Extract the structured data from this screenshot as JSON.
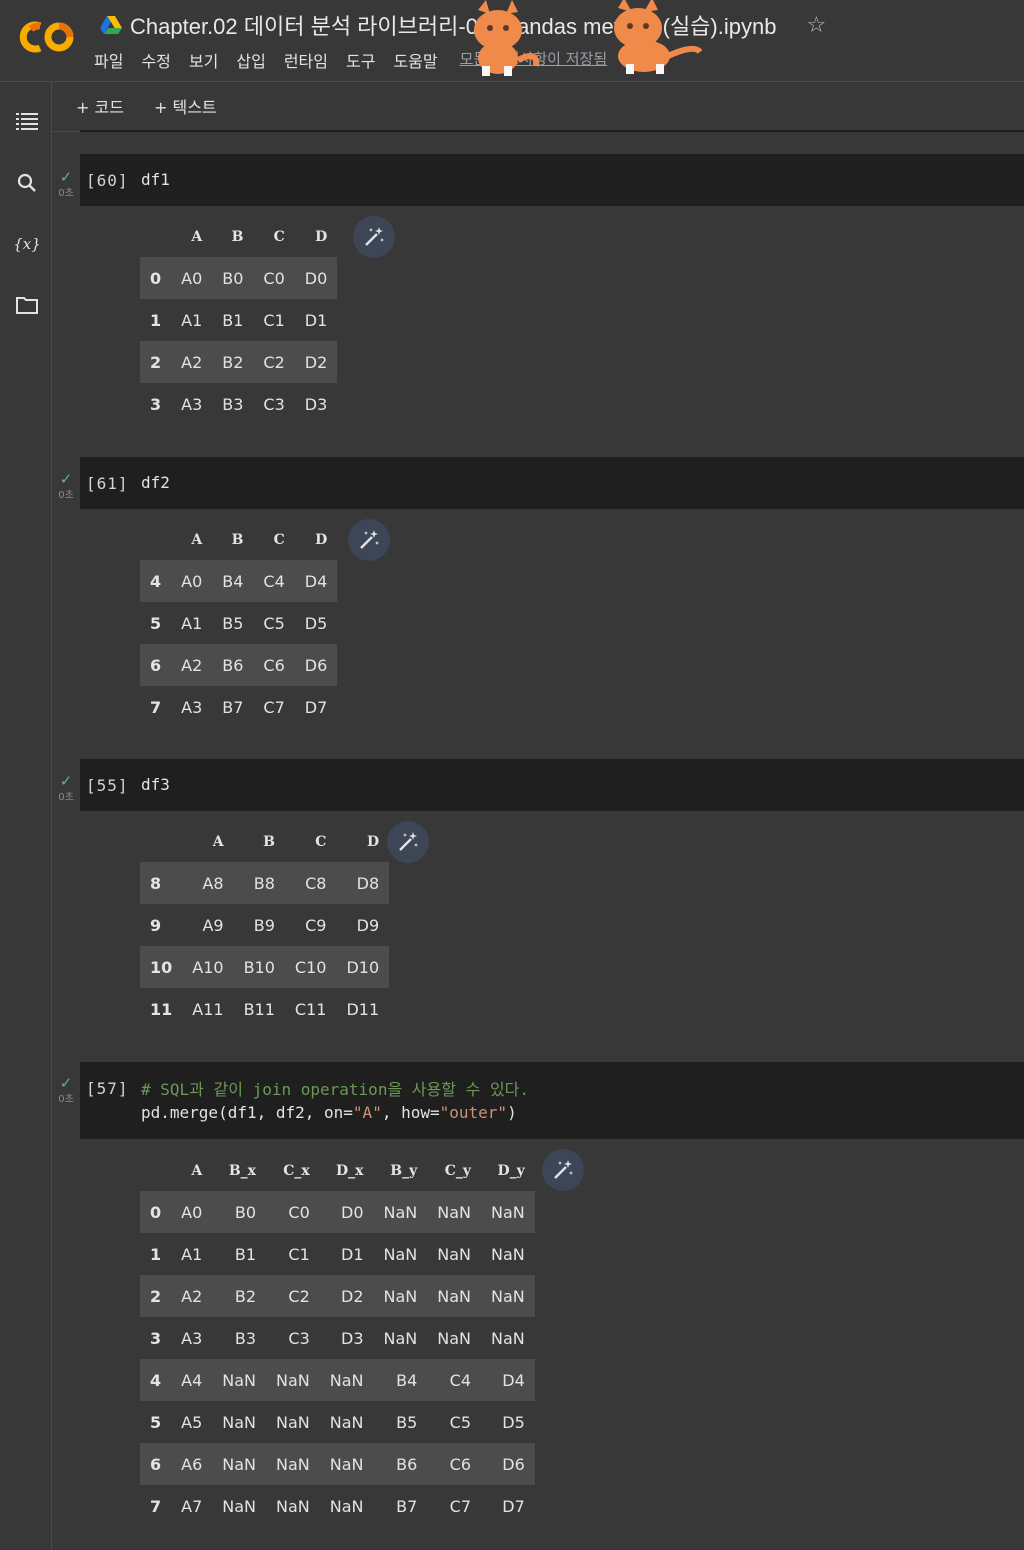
{
  "header": {
    "title": "Chapter.02 데이터 분석 라이브러리-06. Pandas method (실습).ipynb",
    "menu": [
      "파일",
      "수정",
      "보기",
      "삽입",
      "런타임",
      "도구",
      "도움말"
    ],
    "save_status": "모든 변경사항이 저장됨"
  },
  "toolbar": {
    "add_code": "+ 코드",
    "add_text": "+ 텍스트"
  },
  "rail": {
    "icons": [
      "toc-icon",
      "search-icon",
      "variables-icon",
      "folder-icon"
    ]
  },
  "cells": [
    {
      "exec": "[60]",
      "time": "0초",
      "code": [
        "df1"
      ],
      "output": {
        "columns": [
          "",
          "A",
          "B",
          "C",
          "D"
        ],
        "rows": [
          [
            "0",
            "A0",
            "B0",
            "C0",
            "D0"
          ],
          [
            "1",
            "A1",
            "B1",
            "C1",
            "D1"
          ],
          [
            "2",
            "A2",
            "B2",
            "C2",
            "D2"
          ],
          [
            "3",
            "A3",
            "B3",
            "C3",
            "D3"
          ]
        ]
      }
    },
    {
      "exec": "[61]",
      "time": "0초",
      "code": [
        "df2"
      ],
      "output": {
        "columns": [
          "",
          "A",
          "B",
          "C",
          "D"
        ],
        "rows": [
          [
            "4",
            "A0",
            "B4",
            "C4",
            "D4"
          ],
          [
            "5",
            "A1",
            "B5",
            "C5",
            "D5"
          ],
          [
            "6",
            "A2",
            "B6",
            "C6",
            "D6"
          ],
          [
            "7",
            "A3",
            "B7",
            "C7",
            "D7"
          ]
        ]
      }
    },
    {
      "exec": "[55]",
      "time": "0초",
      "code": [
        "df3"
      ],
      "output": {
        "columns": [
          "",
          "A",
          "B",
          "C",
          "D"
        ],
        "rows": [
          [
            "8",
            "A8",
            "B8",
            "C8",
            "D8"
          ],
          [
            "9",
            "A9",
            "B9",
            "C9",
            "D9"
          ],
          [
            "10",
            "A10",
            "B10",
            "C10",
            "D10"
          ],
          [
            "11",
            "A11",
            "B11",
            "C11",
            "D11"
          ]
        ]
      }
    },
    {
      "exec": "[57]",
      "time": "0초",
      "comment": "# SQL과 같이 join operation을 사용할 수 있다.",
      "code_prefix": "pd.merge(df1, df2, on=",
      "code_str1": "\"A\"",
      "code_mid": ", how=",
      "code_str2": "\"outer\"",
      "code_suffix": ")",
      "output": {
        "columns": [
          "",
          "A",
          "B_x",
          "C_x",
          "D_x",
          "B_y",
          "C_y",
          "D_y"
        ],
        "rows": [
          [
            "0",
            "A0",
            "B0",
            "C0",
            "D0",
            "NaN",
            "NaN",
            "NaN"
          ],
          [
            "1",
            "A1",
            "B1",
            "C1",
            "D1",
            "NaN",
            "NaN",
            "NaN"
          ],
          [
            "2",
            "A2",
            "B2",
            "C2",
            "D2",
            "NaN",
            "NaN",
            "NaN"
          ],
          [
            "3",
            "A3",
            "B3",
            "C3",
            "D3",
            "NaN",
            "NaN",
            "NaN"
          ],
          [
            "4",
            "A4",
            "NaN",
            "NaN",
            "NaN",
            "B4",
            "C4",
            "D4"
          ],
          [
            "5",
            "A5",
            "NaN",
            "NaN",
            "NaN",
            "B5",
            "C5",
            "D5"
          ],
          [
            "6",
            "A6",
            "NaN",
            "NaN",
            "NaN",
            "B6",
            "C6",
            "D6"
          ],
          [
            "7",
            "A7",
            "NaN",
            "NaN",
            "NaN",
            "B7",
            "C7",
            "D7"
          ]
        ]
      }
    }
  ]
}
